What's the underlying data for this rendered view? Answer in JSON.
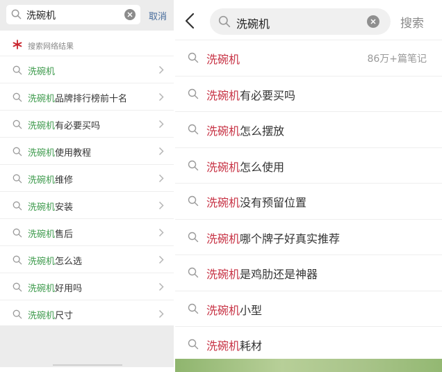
{
  "left": {
    "search": {
      "query": "洗碗机",
      "cancel_label": "取消"
    },
    "section_title": "搜索网络结果",
    "suggestions": [
      {
        "hl": "洗碗机",
        "rest": ""
      },
      {
        "hl": "洗碗机",
        "rest": "品牌排行榜前十名"
      },
      {
        "hl": "洗碗机",
        "rest": "有必要买吗"
      },
      {
        "hl": "洗碗机",
        "rest": "使用教程"
      },
      {
        "hl": "洗碗机",
        "rest": "维修"
      },
      {
        "hl": "洗碗机",
        "rest": "安装"
      },
      {
        "hl": "洗碗机",
        "rest": "售后"
      },
      {
        "hl": "洗碗机",
        "rest": "怎么选"
      },
      {
        "hl": "洗碗机",
        "rest": "好用吗"
      },
      {
        "hl": "洗碗机",
        "rest": "尺寸"
      }
    ]
  },
  "right": {
    "search": {
      "query": "洗碗机",
      "search_label": "搜索"
    },
    "suggestions": [
      {
        "hl": "洗碗机",
        "rest": "",
        "count": "86万+篇笔记"
      },
      {
        "hl": "洗碗机",
        "rest": "有必要买吗"
      },
      {
        "hl": "洗碗机",
        "rest": "怎么摆放"
      },
      {
        "hl": "洗碗机",
        "rest": "怎么使用"
      },
      {
        "hl": "洗碗机",
        "rest": "没有预留位置"
      },
      {
        "hl": "洗碗机",
        "rest": "哪个牌子好真实推荐"
      },
      {
        "hl": "洗碗机",
        "rest": "是鸡肋还是神器"
      },
      {
        "hl": "洗碗机",
        "rest": "小型"
      },
      {
        "hl": "洗碗机",
        "rest": "耗材"
      }
    ]
  },
  "colors": {
    "left_highlight": "#3d9a4c",
    "right_highlight": "#c73244",
    "cancel": "#466b9b",
    "section_icon": "#c8232c"
  }
}
